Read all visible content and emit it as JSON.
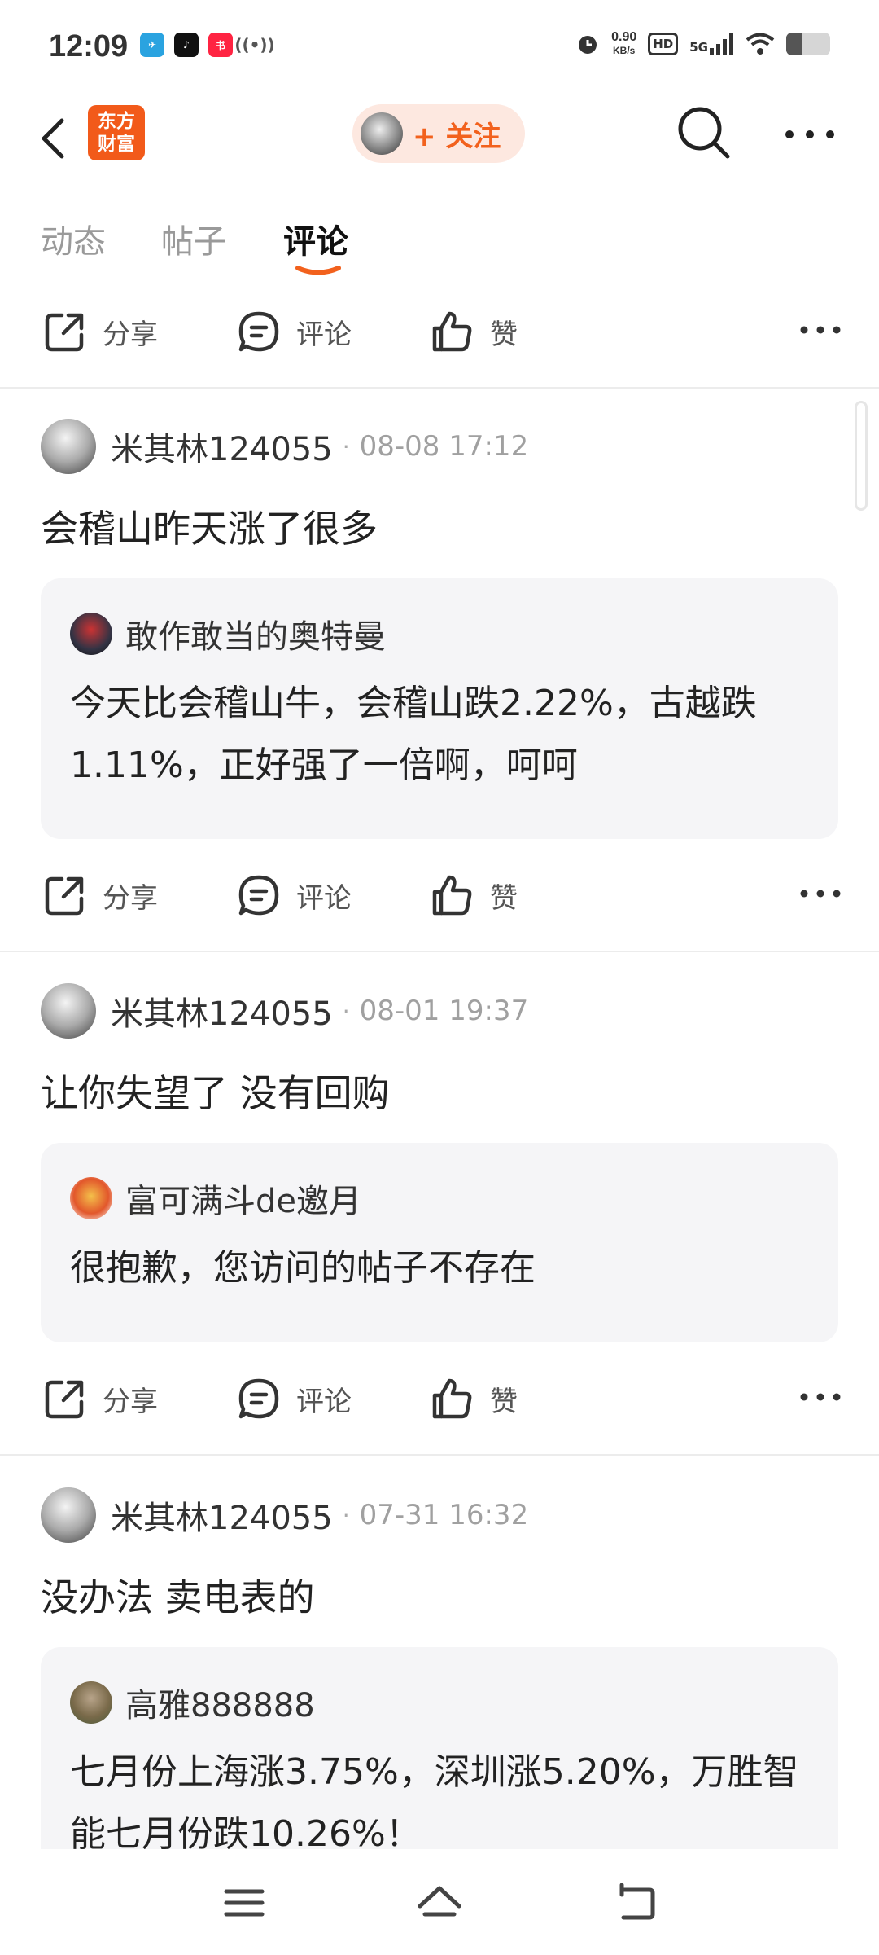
{
  "status_bar": {
    "time": "12:09",
    "net_speed_value": "0.90",
    "net_speed_unit": "KB/s",
    "hd_label": "HD",
    "network_label": "5G",
    "battery_level": 0.35
  },
  "header": {
    "logo_line1": "东方",
    "logo_line2": "财富",
    "follow_label": "+ 关注"
  },
  "tabs": [
    {
      "label": "动态",
      "active": false
    },
    {
      "label": "帖子",
      "active": false
    },
    {
      "label": "评论",
      "active": true
    }
  ],
  "actions": {
    "share": "分享",
    "comment": "评论",
    "like": "赞"
  },
  "posts": [
    {
      "author": "米其林124055",
      "time": "08-08 17:12",
      "text": "会稽山昨天涨了很多",
      "quote": {
        "author": "敢作敢当的奥特曼",
        "body": "今天比会稽山牛，会稽山跌2.22%，古越跌1.11%，正好强了一倍啊，呵呵"
      }
    },
    {
      "author": "米其林124055",
      "time": "08-01 19:37",
      "text": "让你失望了 没有回购",
      "quote": {
        "author": "富可满斗de邀月",
        "body": "很抱歉，您访问的帖子不存在"
      }
    },
    {
      "author": "米其林124055",
      "time": "07-31 16:32",
      "text": "没办法 卖电表的",
      "quote": {
        "author": "高雅888888",
        "body": "七月份上海涨3.75%，深圳涨5.20%，万胜智能七月份跌10.26%！"
      }
    }
  ],
  "colors": {
    "brand_orange": "#f2611d",
    "quote_bg": "#f5f5f7",
    "muted_text": "#a0a0a0"
  }
}
